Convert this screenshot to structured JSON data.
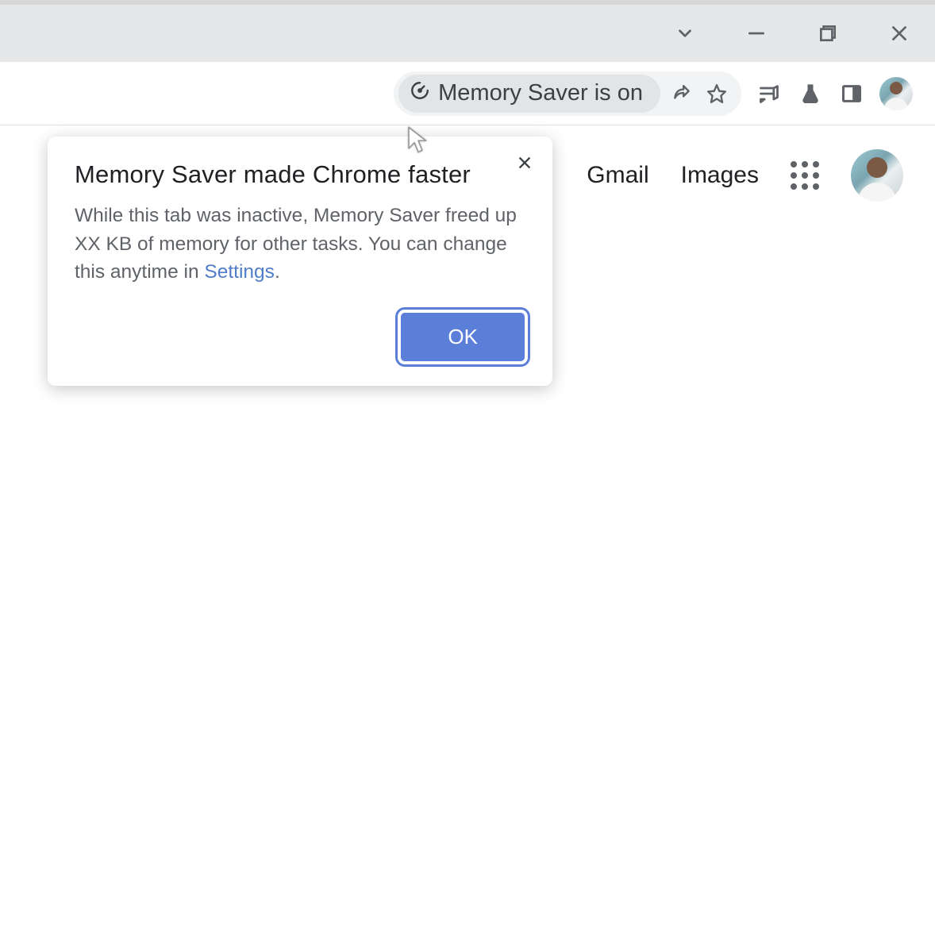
{
  "window_controls": {
    "dropdown": "chevron-down",
    "minimize": "minimize",
    "maximize": "maximize",
    "close": "close"
  },
  "omnibox": {
    "chip_label": "Memory Saver is on",
    "share_icon": "share-icon",
    "bookmark_icon": "star-icon"
  },
  "extensions": {
    "media": "media-controls-icon",
    "labs": "labs-icon",
    "sidepanel": "side-panel-icon"
  },
  "page_header": {
    "gmail": "Gmail",
    "images": "Images"
  },
  "popup": {
    "title": "Memory Saver made Chrome faster",
    "body_before_link": "While this tab was inactive, Memory Saver freed up XX KB of memory for other tasks. You can change this anytime in ",
    "settings_link": "Settings",
    "body_after_link": ".",
    "ok_label": "OK"
  }
}
